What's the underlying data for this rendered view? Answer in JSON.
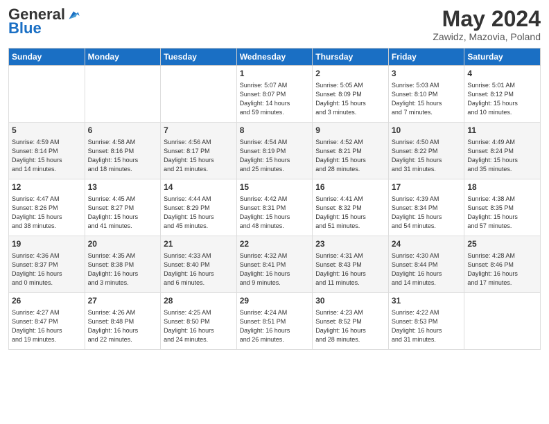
{
  "header": {
    "logo_general": "General",
    "logo_blue": "Blue",
    "month_title": "May 2024",
    "location": "Zawidz, Mazovia, Poland"
  },
  "weekdays": [
    "Sunday",
    "Monday",
    "Tuesday",
    "Wednesday",
    "Thursday",
    "Friday",
    "Saturday"
  ],
  "weeks": [
    [
      {
        "day": "",
        "info": ""
      },
      {
        "day": "",
        "info": ""
      },
      {
        "day": "",
        "info": ""
      },
      {
        "day": "1",
        "info": "Sunrise: 5:07 AM\nSunset: 8:07 PM\nDaylight: 14 hours\nand 59 minutes."
      },
      {
        "day": "2",
        "info": "Sunrise: 5:05 AM\nSunset: 8:09 PM\nDaylight: 15 hours\nand 3 minutes."
      },
      {
        "day": "3",
        "info": "Sunrise: 5:03 AM\nSunset: 8:10 PM\nDaylight: 15 hours\nand 7 minutes."
      },
      {
        "day": "4",
        "info": "Sunrise: 5:01 AM\nSunset: 8:12 PM\nDaylight: 15 hours\nand 10 minutes."
      }
    ],
    [
      {
        "day": "5",
        "info": "Sunrise: 4:59 AM\nSunset: 8:14 PM\nDaylight: 15 hours\nand 14 minutes."
      },
      {
        "day": "6",
        "info": "Sunrise: 4:58 AM\nSunset: 8:16 PM\nDaylight: 15 hours\nand 18 minutes."
      },
      {
        "day": "7",
        "info": "Sunrise: 4:56 AM\nSunset: 8:17 PM\nDaylight: 15 hours\nand 21 minutes."
      },
      {
        "day": "8",
        "info": "Sunrise: 4:54 AM\nSunset: 8:19 PM\nDaylight: 15 hours\nand 25 minutes."
      },
      {
        "day": "9",
        "info": "Sunrise: 4:52 AM\nSunset: 8:21 PM\nDaylight: 15 hours\nand 28 minutes."
      },
      {
        "day": "10",
        "info": "Sunrise: 4:50 AM\nSunset: 8:22 PM\nDaylight: 15 hours\nand 31 minutes."
      },
      {
        "day": "11",
        "info": "Sunrise: 4:49 AM\nSunset: 8:24 PM\nDaylight: 15 hours\nand 35 minutes."
      }
    ],
    [
      {
        "day": "12",
        "info": "Sunrise: 4:47 AM\nSunset: 8:26 PM\nDaylight: 15 hours\nand 38 minutes."
      },
      {
        "day": "13",
        "info": "Sunrise: 4:45 AM\nSunset: 8:27 PM\nDaylight: 15 hours\nand 41 minutes."
      },
      {
        "day": "14",
        "info": "Sunrise: 4:44 AM\nSunset: 8:29 PM\nDaylight: 15 hours\nand 45 minutes."
      },
      {
        "day": "15",
        "info": "Sunrise: 4:42 AM\nSunset: 8:31 PM\nDaylight: 15 hours\nand 48 minutes."
      },
      {
        "day": "16",
        "info": "Sunrise: 4:41 AM\nSunset: 8:32 PM\nDaylight: 15 hours\nand 51 minutes."
      },
      {
        "day": "17",
        "info": "Sunrise: 4:39 AM\nSunset: 8:34 PM\nDaylight: 15 hours\nand 54 minutes."
      },
      {
        "day": "18",
        "info": "Sunrise: 4:38 AM\nSunset: 8:35 PM\nDaylight: 15 hours\nand 57 minutes."
      }
    ],
    [
      {
        "day": "19",
        "info": "Sunrise: 4:36 AM\nSunset: 8:37 PM\nDaylight: 16 hours\nand 0 minutes."
      },
      {
        "day": "20",
        "info": "Sunrise: 4:35 AM\nSunset: 8:38 PM\nDaylight: 16 hours\nand 3 minutes."
      },
      {
        "day": "21",
        "info": "Sunrise: 4:33 AM\nSunset: 8:40 PM\nDaylight: 16 hours\nand 6 minutes."
      },
      {
        "day": "22",
        "info": "Sunrise: 4:32 AM\nSunset: 8:41 PM\nDaylight: 16 hours\nand 9 minutes."
      },
      {
        "day": "23",
        "info": "Sunrise: 4:31 AM\nSunset: 8:43 PM\nDaylight: 16 hours\nand 11 minutes."
      },
      {
        "day": "24",
        "info": "Sunrise: 4:30 AM\nSunset: 8:44 PM\nDaylight: 16 hours\nand 14 minutes."
      },
      {
        "day": "25",
        "info": "Sunrise: 4:28 AM\nSunset: 8:46 PM\nDaylight: 16 hours\nand 17 minutes."
      }
    ],
    [
      {
        "day": "26",
        "info": "Sunrise: 4:27 AM\nSunset: 8:47 PM\nDaylight: 16 hours\nand 19 minutes."
      },
      {
        "day": "27",
        "info": "Sunrise: 4:26 AM\nSunset: 8:48 PM\nDaylight: 16 hours\nand 22 minutes."
      },
      {
        "day": "28",
        "info": "Sunrise: 4:25 AM\nSunset: 8:50 PM\nDaylight: 16 hours\nand 24 minutes."
      },
      {
        "day": "29",
        "info": "Sunrise: 4:24 AM\nSunset: 8:51 PM\nDaylight: 16 hours\nand 26 minutes."
      },
      {
        "day": "30",
        "info": "Sunrise: 4:23 AM\nSunset: 8:52 PM\nDaylight: 16 hours\nand 28 minutes."
      },
      {
        "day": "31",
        "info": "Sunrise: 4:22 AM\nSunset: 8:53 PM\nDaylight: 16 hours\nand 31 minutes."
      },
      {
        "day": "",
        "info": ""
      }
    ]
  ]
}
